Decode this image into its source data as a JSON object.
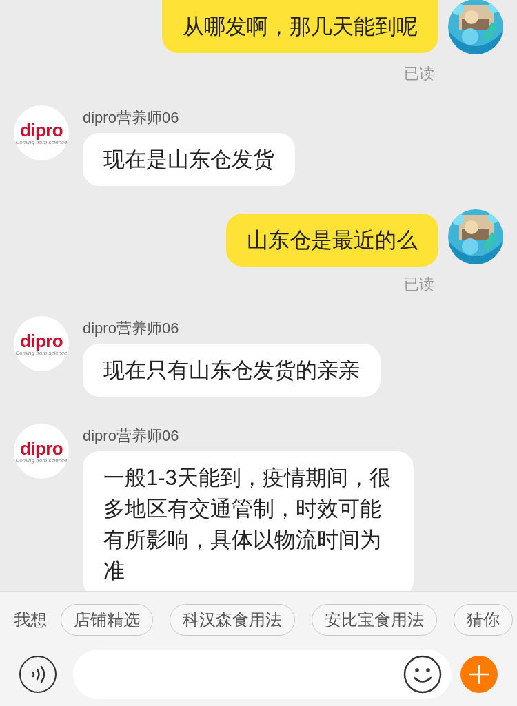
{
  "messages": [
    {
      "kind": "outgoing",
      "text": "从哪发啊，那几天能到呢",
      "status": "已读"
    },
    {
      "kind": "incoming",
      "sender": "dipro营养师06",
      "logo": "dipro",
      "tagline": "Coming from science",
      "text": "现在是山东仓发货"
    },
    {
      "kind": "outgoing",
      "text": "山东仓是最近的么",
      "status": "已读"
    },
    {
      "kind": "incoming",
      "sender": "dipro营养师06",
      "logo": "dipro",
      "tagline": "Coming from science",
      "text": "现在只有山东仓发货的亲亲"
    },
    {
      "kind": "incoming",
      "sender": "dipro营养师06",
      "logo": "dipro",
      "tagline": "Coming from science",
      "text": "一般1-3天能到，疫情期间，很多地区有交通管制，时效可能有所影响，具体以物流时间为准"
    }
  ],
  "suggestions": {
    "label": "我想",
    "chips": [
      "店铺精选",
      "科汉森食用法",
      "安比宝食用法",
      "猜你"
    ]
  }
}
